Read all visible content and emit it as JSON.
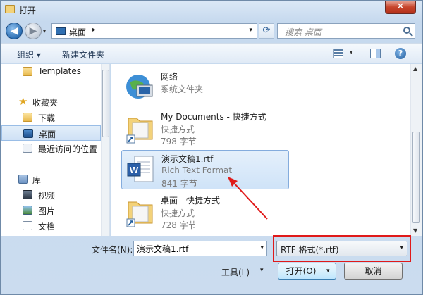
{
  "window": {
    "title": "打开",
    "close": "✕"
  },
  "address": {
    "location": "桌面",
    "chevron": "▸",
    "dropdown": "▾"
  },
  "search": {
    "placeholder": "搜索 桌面"
  },
  "nav_buttons": {
    "back": "◀",
    "forward": "▶",
    "history": "▾",
    "refresh": "⟳"
  },
  "toolbar": {
    "organize": "组织 ▾",
    "new_folder": "新建文件夹",
    "view_dropdown": "▾",
    "help": "?"
  },
  "sidebar": {
    "items": [
      {
        "label": "Templates",
        "icon": "folder-icon"
      },
      {
        "label": "收藏夹",
        "icon": "star-icon"
      },
      {
        "label": "下载",
        "icon": "download-folder-icon"
      },
      {
        "label": "桌面",
        "icon": "desktop-icon",
        "selected": true
      },
      {
        "label": "最近访问的位置",
        "icon": "recent-places-icon"
      },
      {
        "label": "库",
        "icon": "library-icon"
      },
      {
        "label": "视频",
        "icon": "video-icon"
      },
      {
        "label": "图片",
        "icon": "pictures-icon"
      },
      {
        "label": "文档",
        "icon": "documents-icon"
      }
    ]
  },
  "files": [
    {
      "name": "网络",
      "type": "系统文件夹",
      "size": "",
      "icon": "network-icon"
    },
    {
      "name": "My Documents - 快捷方式",
      "type": "快捷方式",
      "size": "798 字节",
      "icon": "shortcut-folder-icon"
    },
    {
      "name": "演示文稿1.rtf",
      "type": "Rich Text Format",
      "size": "841 字节",
      "icon": "word-document-icon",
      "selected": true
    },
    {
      "name": "桌面 - 快捷方式",
      "type": "快捷方式",
      "size": "728 字节",
      "icon": "shortcut-folder-icon"
    }
  ],
  "bottom": {
    "filename_label": "文件名(N):",
    "filename_value": "演示文稿1.rtf",
    "filter": "RTF 格式(*.rtf)",
    "tools": "工具(L)",
    "open": "打开(O)",
    "cancel": "取消",
    "dropdown": "▾"
  },
  "colors": {
    "highlight": "#e01a1a",
    "selection": "#cfe3f8",
    "accent": "#2c6fb4"
  }
}
